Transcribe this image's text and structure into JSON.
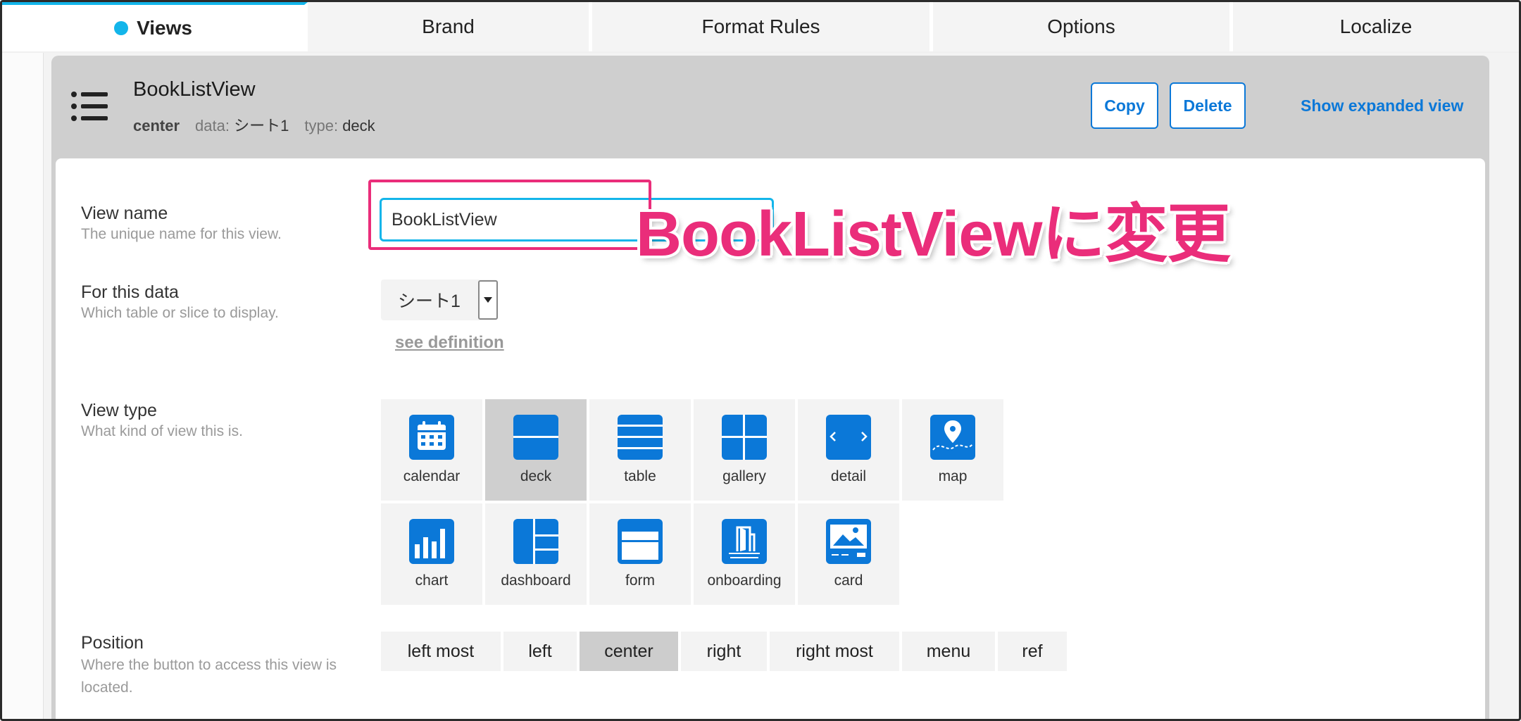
{
  "tabs": [
    {
      "label": "Views",
      "active": true
    },
    {
      "label": "Brand",
      "active": false
    },
    {
      "label": "Format Rules",
      "active": false
    },
    {
      "label": "Options",
      "active": false
    },
    {
      "label": "Localize",
      "active": false
    }
  ],
  "accent_color": "#13b5ea",
  "link_color": "#0b78d8",
  "annotation_color": "#ea2d7a",
  "header": {
    "icon": "list-icon",
    "title": "BookListView",
    "position": "center",
    "data_label": "data:",
    "data_value": "シート1",
    "type_label": "type:",
    "type_value": "deck",
    "copy_label": "Copy",
    "delete_label": "Delete",
    "expand_label": "Show expanded view"
  },
  "form": {
    "view_name": {
      "label": "View name",
      "help": "The unique name for this view.",
      "value": "BookListView"
    },
    "annotation": "BookListViewに変更",
    "for_this_data": {
      "label": "For this data",
      "help": "Which table or slice to display.",
      "selected": "シート1",
      "see_definition": "see definition"
    },
    "view_type": {
      "label": "View type",
      "help": "What kind of view this is.",
      "options": [
        {
          "label": "calendar",
          "icon": "calendar-icon",
          "selected": false
        },
        {
          "label": "deck",
          "icon": "deck-icon",
          "selected": true
        },
        {
          "label": "table",
          "icon": "table-icon",
          "selected": false
        },
        {
          "label": "gallery",
          "icon": "gallery-icon",
          "selected": false
        },
        {
          "label": "detail",
          "icon": "detail-icon",
          "selected": false
        },
        {
          "label": "map",
          "icon": "map-icon",
          "selected": false
        },
        {
          "label": "chart",
          "icon": "chart-icon",
          "selected": false
        },
        {
          "label": "dashboard",
          "icon": "dashboard-icon",
          "selected": false
        },
        {
          "label": "form",
          "icon": "form-icon",
          "selected": false
        },
        {
          "label": "onboarding",
          "icon": "onboarding-icon",
          "selected": false
        },
        {
          "label": "card",
          "icon": "card-icon",
          "selected": false
        }
      ]
    },
    "position": {
      "label": "Position",
      "help": "Where the button to access this view is located.",
      "options": [
        {
          "label": "left most",
          "selected": false
        },
        {
          "label": "left",
          "selected": false
        },
        {
          "label": "center",
          "selected": true
        },
        {
          "label": "right",
          "selected": false
        },
        {
          "label": "right most",
          "selected": false
        },
        {
          "label": "menu",
          "selected": false
        },
        {
          "label": "ref",
          "selected": false
        }
      ]
    }
  }
}
